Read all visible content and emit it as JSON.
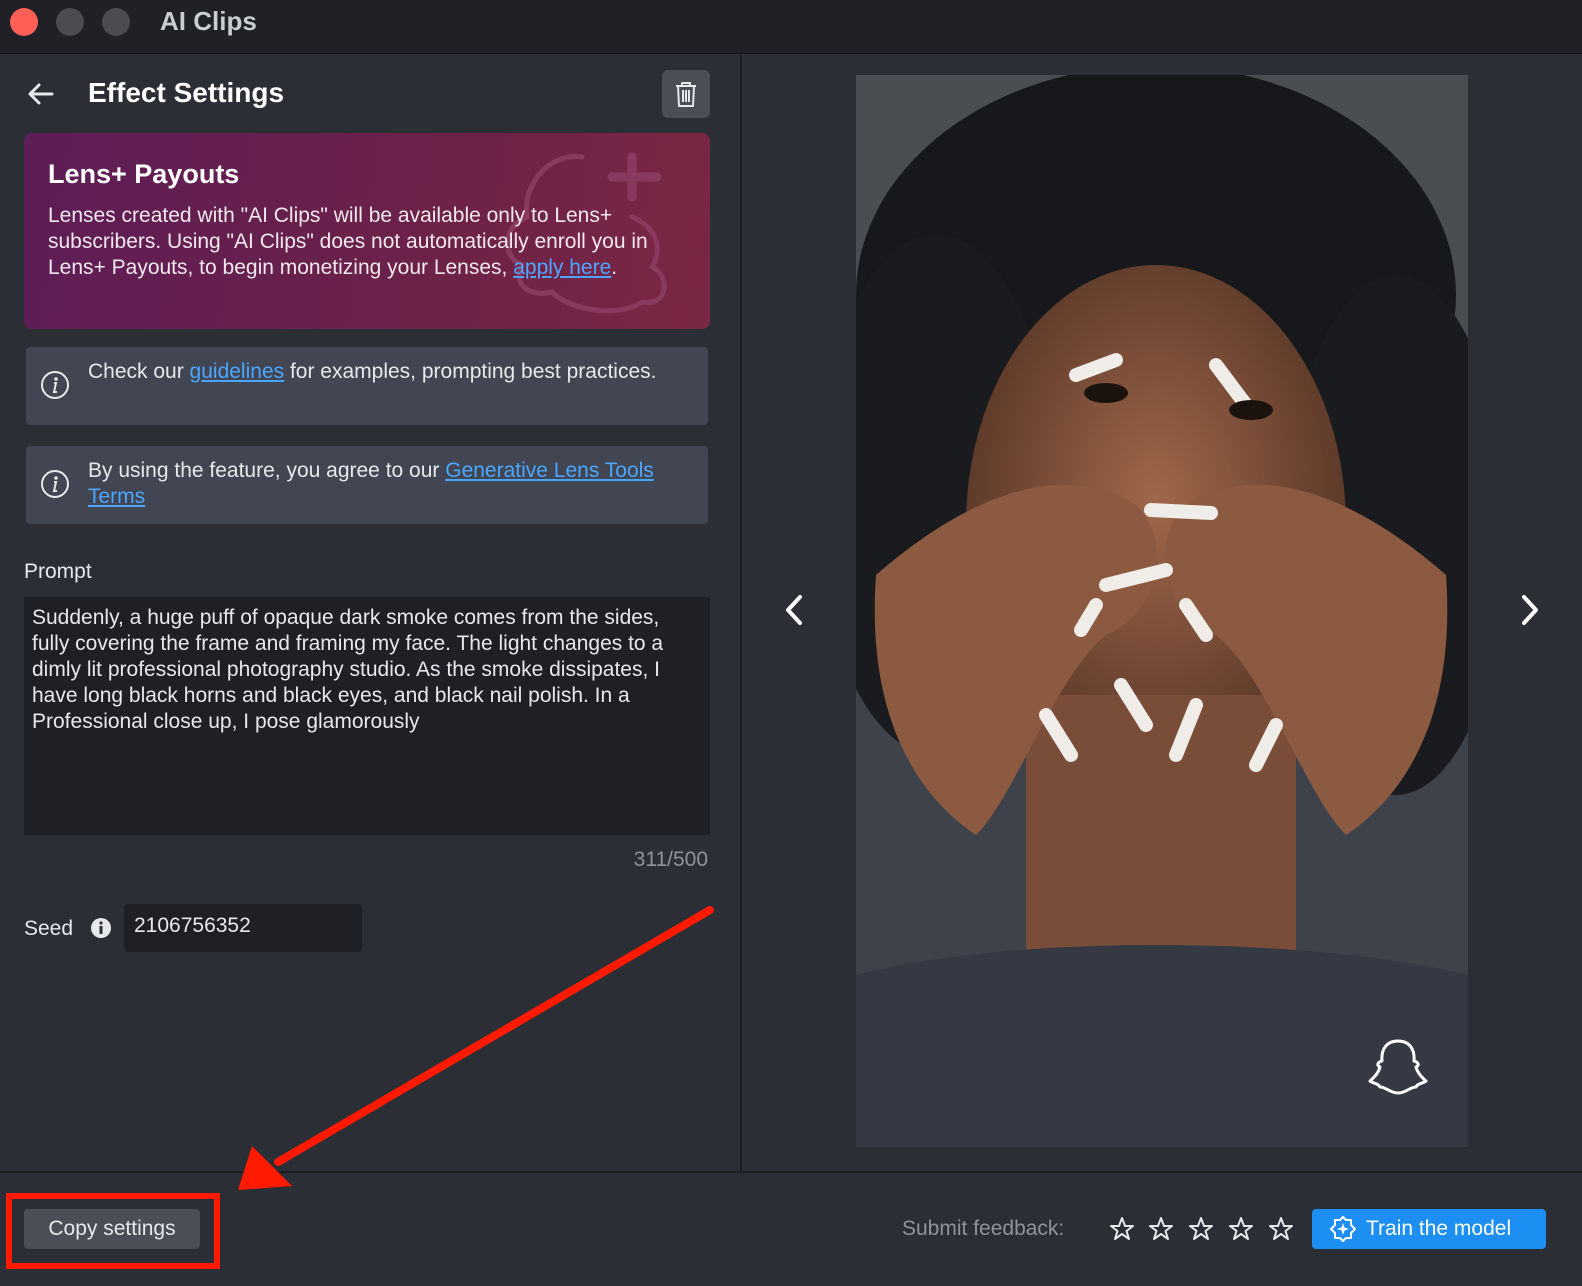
{
  "window": {
    "title": "AI Clips"
  },
  "panel": {
    "title": "Effect Settings",
    "payouts": {
      "title": "Lens+ Payouts",
      "text": "Lenses created with \"AI Clips\" will be available only to Lens+ subscribers. Using \"AI Clips\" does not automatically enroll you in Lens+ Payouts, to begin monetizing your Lenses, ",
      "link": "apply here",
      "suffix": "."
    },
    "info1": {
      "before": "Check our ",
      "link": "guidelines",
      "after": " for examples, prompting best practices."
    },
    "info2": {
      "before": "By using the feature, you agree to our ",
      "link": "Generative Lens Tools Terms"
    },
    "prompt": {
      "label": "Prompt",
      "value": "Suddenly, a huge puff of opaque dark smoke comes from the sides, fully covering the frame and framing my face. The light changes to a dimly lit professional photography studio. As the smoke dissipates, I have long black horns and black eyes, and black nail polish. In a Professional close up, I pose glamorously",
      "counter": "311/500"
    },
    "seed": {
      "label": "Seed",
      "value": "2106756352"
    }
  },
  "footer": {
    "copy_label": "Copy settings",
    "feedback_label": "Submit feedback:",
    "rating": 0,
    "train_label": "Train the model"
  },
  "colors": {
    "accent": "#1d8ff3",
    "highlight": "#ff1a00",
    "payouts_bg": "#6b2149"
  }
}
